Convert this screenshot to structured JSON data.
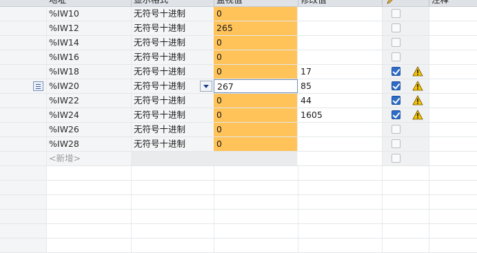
{
  "columns": {
    "address": "地址",
    "display_format": "显示格式",
    "monitor_value": "监视值",
    "modify_value": "修改值",
    "modify_icon": "pencil-icon",
    "comment": "注释"
  },
  "rows": [
    {
      "address": "%IW10",
      "format": "无符号十进制",
      "monitor": "0",
      "modify": "",
      "checked": false,
      "warning": false
    },
    {
      "address": "%IW12",
      "format": "无符号十进制",
      "monitor": "265",
      "modify": "",
      "checked": false,
      "warning": false
    },
    {
      "address": "%IW14",
      "format": "无符号十进制",
      "monitor": "0",
      "modify": "",
      "checked": false,
      "warning": false
    },
    {
      "address": "%IW16",
      "format": "无符号十进制",
      "monitor": "0",
      "modify": "",
      "checked": false,
      "warning": false
    },
    {
      "address": "%IW18",
      "format": "无符号十进制",
      "monitor": "0",
      "modify": "17",
      "checked": true,
      "warning": true
    },
    {
      "address": "%IW20",
      "format": "无符号十进制",
      "monitor": "267",
      "modify": "85",
      "checked": true,
      "warning": true,
      "selected": true
    },
    {
      "address": "%IW22",
      "format": "无符号十进制",
      "monitor": "0",
      "modify": "44",
      "checked": true,
      "warning": true
    },
    {
      "address": "%IW24",
      "format": "无符号十进制",
      "monitor": "0",
      "modify": "1605",
      "checked": true,
      "warning": true
    },
    {
      "address": "%IW26",
      "format": "无符号十进制",
      "monitor": "0",
      "modify": "",
      "checked": false,
      "warning": false
    },
    {
      "address": "%IW28",
      "format": "无符号十进制",
      "monitor": "0",
      "modify": "",
      "checked": false,
      "warning": false
    }
  ],
  "new_row": {
    "address": "<新增>"
  },
  "colors": {
    "monitor_bg": "#ffc35a",
    "checkbox_on": "#2e6cc8",
    "warning": "#f5c400"
  }
}
